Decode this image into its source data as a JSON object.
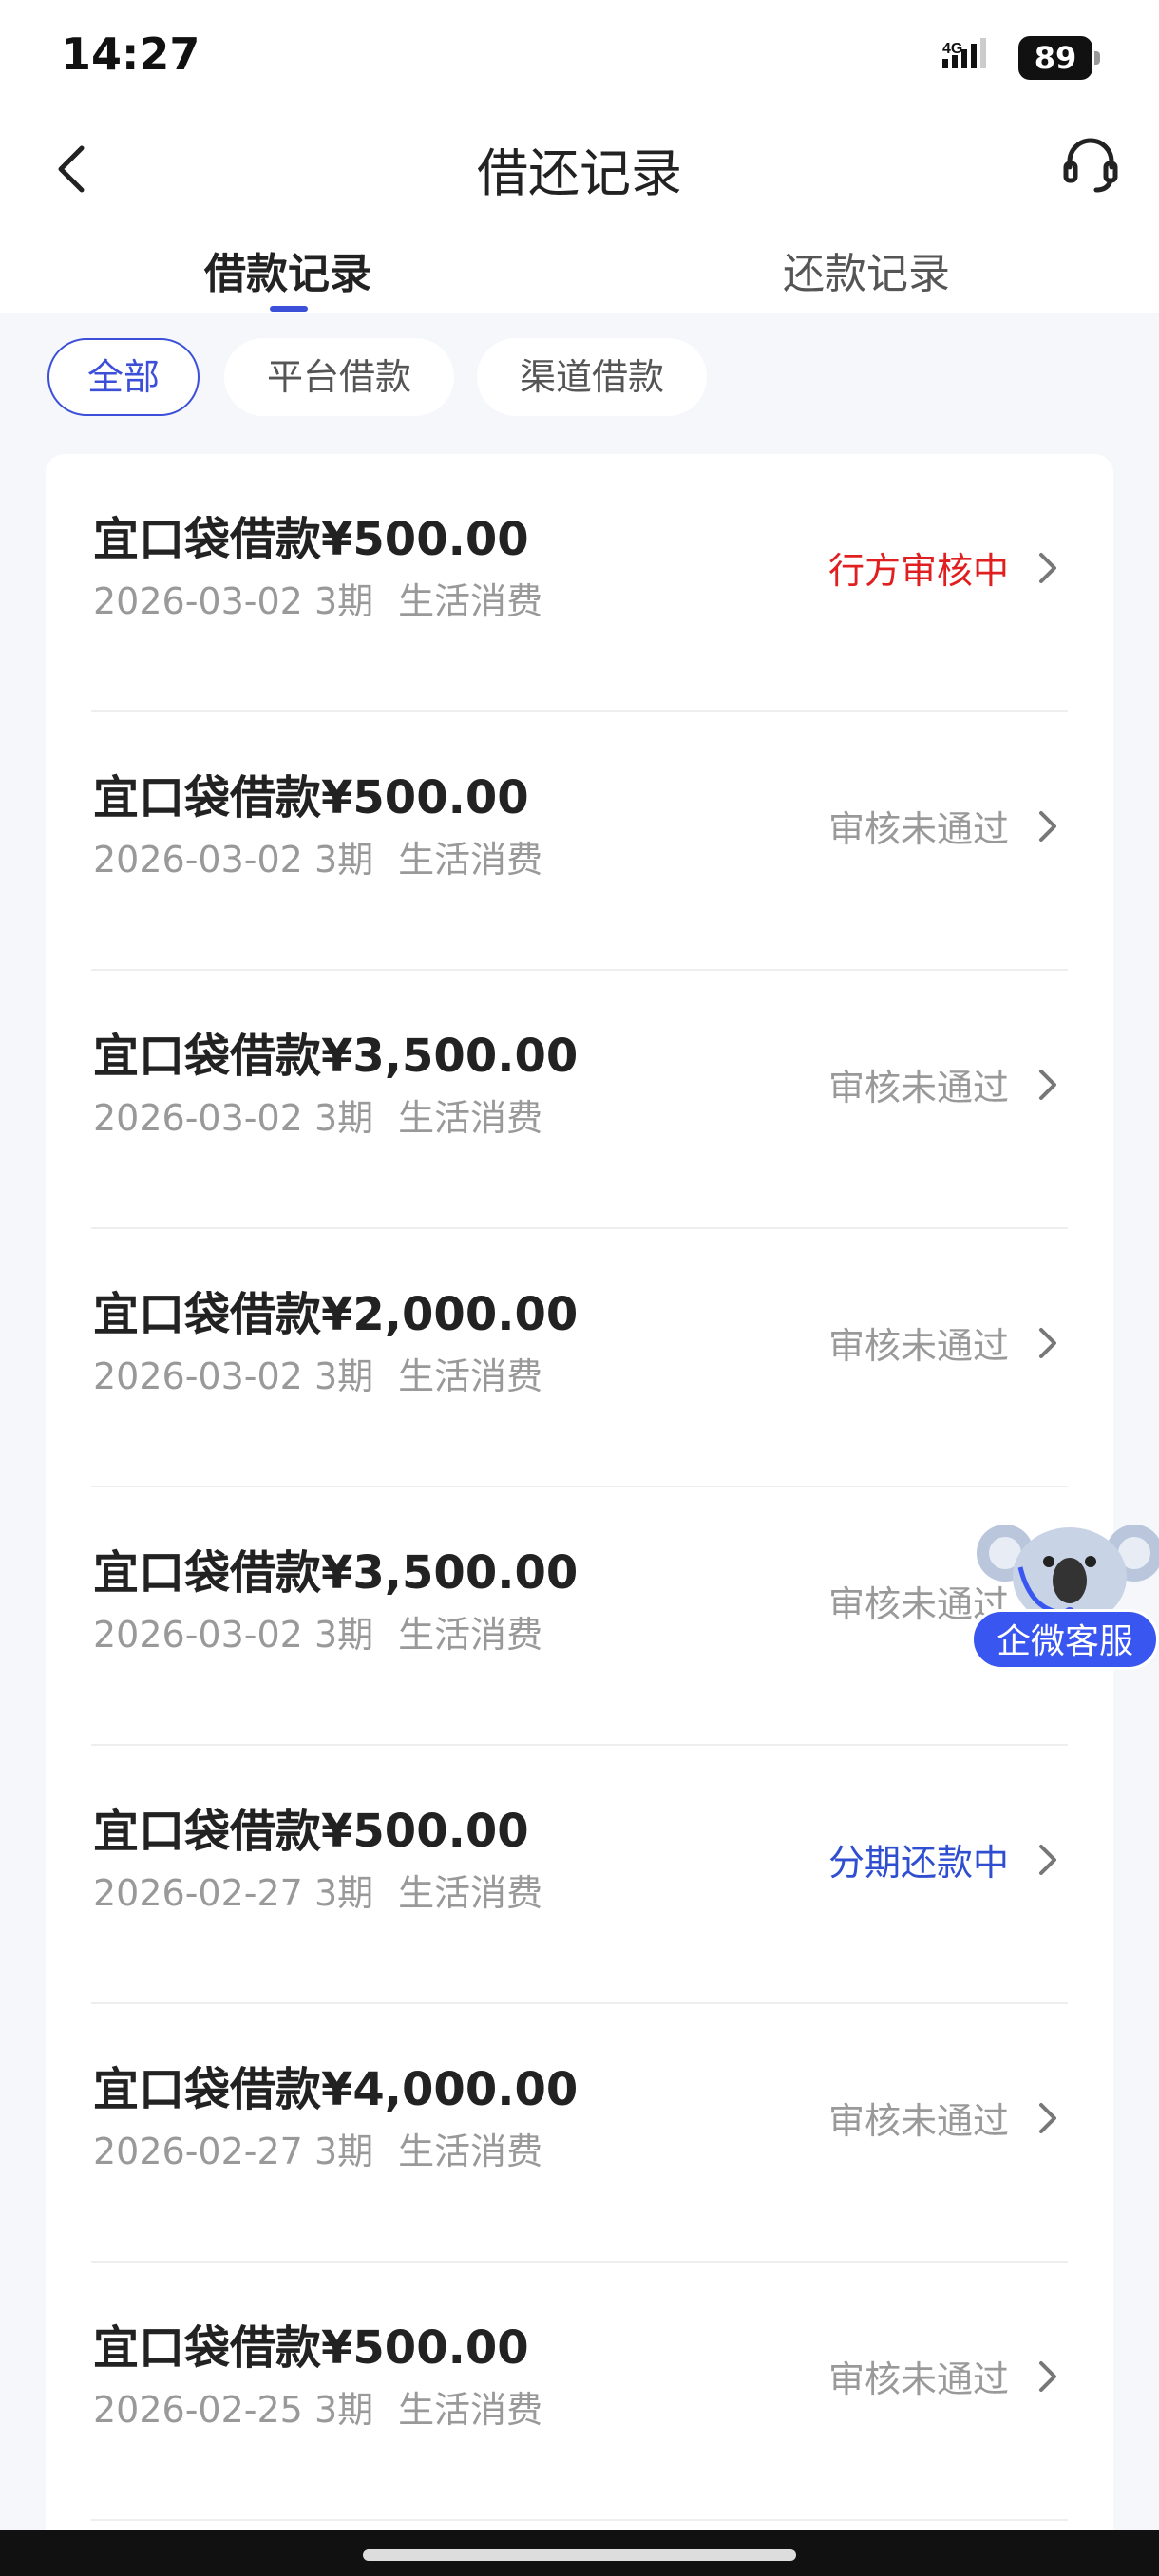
{
  "status_bar": {
    "time": "14:27",
    "network": "4G",
    "battery": "89"
  },
  "header": {
    "title": "借还记录"
  },
  "tabs": [
    {
      "label": "借款记录",
      "active": true
    },
    {
      "label": "还款记录",
      "active": false
    }
  ],
  "filters": [
    {
      "label": "全部",
      "selected": true
    },
    {
      "label": "平台借款",
      "selected": false
    },
    {
      "label": "渠道借款",
      "selected": false
    }
  ],
  "records": [
    {
      "title": "宜口袋借款¥500.00",
      "date": "2026-03-02",
      "term": "3期",
      "purpose": "生活消费",
      "status": "行方审核中",
      "status_color": "#e02020"
    },
    {
      "title": "宜口袋借款¥500.00",
      "date": "2026-03-02",
      "term": "3期",
      "purpose": "生活消费",
      "status": "审核未通过",
      "status_color": "#999999"
    },
    {
      "title": "宜口袋借款¥3,500.00",
      "date": "2026-03-02",
      "term": "3期",
      "purpose": "生活消费",
      "status": "审核未通过",
      "status_color": "#999999"
    },
    {
      "title": "宜口袋借款¥2,000.00",
      "date": "2026-03-02",
      "term": "3期",
      "purpose": "生活消费",
      "status": "审核未通过",
      "status_color": "#999999"
    },
    {
      "title": "宜口袋借款¥3,500.00",
      "date": "2026-03-02",
      "term": "3期",
      "purpose": "生活消费",
      "status": "审核未通过",
      "status_color": "#999999"
    },
    {
      "title": "宜口袋借款¥500.00",
      "date": "2026-02-27",
      "term": "3期",
      "purpose": "生活消费",
      "status": "分期还款中",
      "status_color": "#2f4fd0"
    },
    {
      "title": "宜口袋借款¥4,000.00",
      "date": "2026-02-27",
      "term": "3期",
      "purpose": "生活消费",
      "status": "审核未通过",
      "status_color": "#999999"
    },
    {
      "title": "宜口袋借款¥500.00",
      "date": "2026-02-25",
      "term": "3期",
      "purpose": "生活消费",
      "status": "审核未通过",
      "status_color": "#999999"
    }
  ],
  "floating_service": {
    "label": "企微客服"
  },
  "colors": {
    "accent": "#3c4fd8",
    "pending": "#e02020",
    "repaying": "#2f4fd0",
    "rejected": "#999999"
  }
}
